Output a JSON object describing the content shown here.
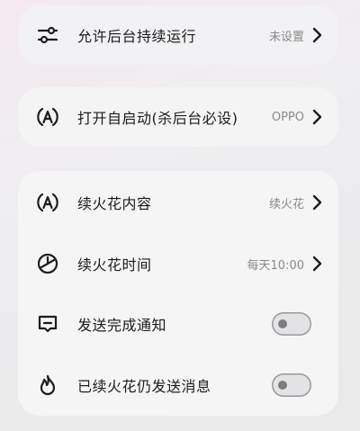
{
  "settings": {
    "background_run": {
      "icon": "sliders-icon",
      "label": "允许后台持续运行",
      "value": "未设置"
    },
    "auto_start": {
      "icon": "a-badge-icon",
      "label": "打开自启动(杀后台必设)",
      "value": "OPPO"
    },
    "content": {
      "icon": "a-badge-icon",
      "label": "续火花内容",
      "value": "续火花"
    },
    "time": {
      "icon": "clock-icon",
      "label": "续火花时间",
      "value": "每天10:00"
    },
    "notify": {
      "icon": "message-icon",
      "label": "发送完成通知",
      "toggle_on": false
    },
    "resend": {
      "icon": "flame-icon",
      "label": "已续火花仍发送消息",
      "toggle_on": false
    }
  },
  "colors": {
    "text": "#1c1c1c",
    "secondary_text": "#8a8a8a",
    "card_bg": "#f5f5f6",
    "toggle_border": "#9a9a9c"
  }
}
